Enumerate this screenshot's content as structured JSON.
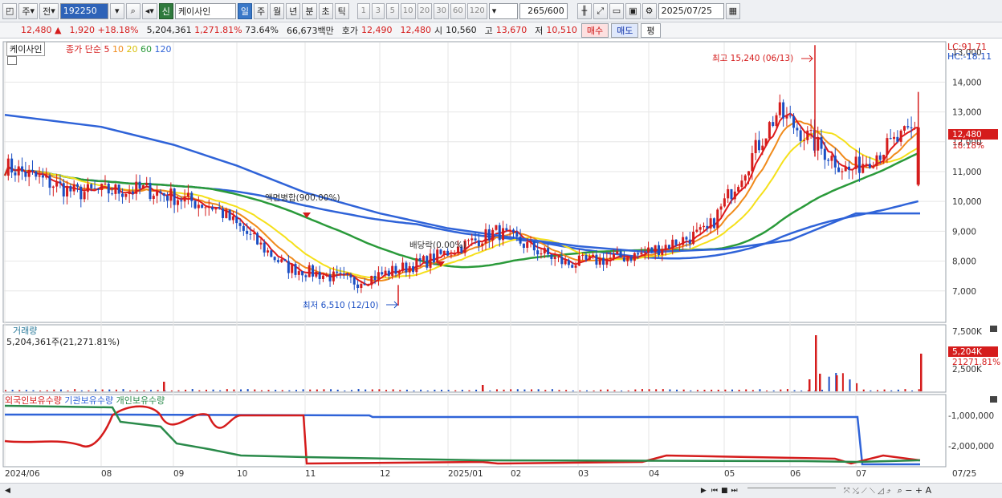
{
  "toolbar": {
    "period": "주",
    "prev": "전",
    "code": "192250",
    "credit_badge": "신",
    "stock_name": "케이사인",
    "intervals": [
      "일",
      "주",
      "월",
      "년",
      "분",
      "초",
      "틱"
    ],
    "active_interval": "일",
    "steps": [
      "1",
      "3",
      "5",
      "10",
      "20",
      "30",
      "60",
      "120"
    ],
    "count": "265",
    "count_total": "/600",
    "date": "2025/07/25"
  },
  "quote": {
    "price": "12,480",
    "arrow": "▲",
    "change": "1,920",
    "change_pct": "+18.18%",
    "volume": "5,204,361",
    "volume_pct": "1,271.81%",
    "turnover": "73.64%",
    "amount": "66,673백만",
    "hoga_label": "호가",
    "hoga1": "12,490",
    "hoga2": "12,480",
    "open_label": "시",
    "open": "10,560",
    "high_label": "고",
    "high": "13,670",
    "low_label": "저",
    "low": "10,510",
    "buy": "매수",
    "sell": "매도",
    "eval": "평"
  },
  "colors": {
    "up": "#d51c1c",
    "down": "#1b4fc4",
    "ma5": "#e01a1a",
    "ma10": "#f08a1a",
    "ma20": "#f5e01a",
    "ma60": "#2a9a3a",
    "ma120": "#2f63d8",
    "foreign": "#d51c1c",
    "institution": "#2f63d8",
    "individual": "#2a8a4a"
  },
  "price_panel": {
    "stock_label": "케이사인",
    "legend_prefix": "종가 단순",
    "ma_periods": [
      "5",
      "10",
      "20",
      "60",
      "120"
    ],
    "lc": "LC:91.71",
    "hc": "HC:-18.11",
    "high_note": "최고 15,240 (06/13)",
    "low_note": "최저 6,510 (12/10)",
    "event1": "액면병합(900.00%)",
    "event2": "배당락(0.00%)",
    "current_price_tag": "12,480",
    "current_pct_tag": "18.18%",
    "y_ticks": [
      "13,000",
      "14,000",
      "13,000",
      "12,000",
      "11,000",
      "10,000",
      "9,000",
      "8,000",
      "7,000"
    ]
  },
  "volume_panel": {
    "title": "거래량",
    "value": "5,204,361주(21,271.81%)",
    "y_ticks": [
      "7,500K",
      "2,500K"
    ],
    "current_tag": "5,204K",
    "current_pct_tag": "21271.81%"
  },
  "holding_panel": {
    "series": [
      "외국인보유수량",
      "기관보유수량",
      "개인보유수량"
    ],
    "y_ticks": [
      "-1,000,000",
      "-2,000,000"
    ]
  },
  "x_axis": [
    "2024/06",
    "08",
    "09",
    "10",
    "11",
    "12",
    "2025/01",
    "02",
    "03",
    "04",
    "05",
    "06",
    "07",
    "07/25"
  ],
  "chart_data": {
    "type": "candlestick",
    "price_ylim": [
      6000,
      15300
    ],
    "x_labels": [
      "2024/06",
      "08",
      "09",
      "10",
      "11",
      "12",
      "2025/01",
      "02",
      "03",
      "04",
      "05",
      "06",
      "07"
    ],
    "close_by_month": [
      11200,
      10300,
      10400,
      9800,
      7800,
      7300,
      8000,
      9000,
      7900,
      8200,
      9000,
      13000,
      11000
    ],
    "ma120_by_month": [
      12900,
      12500,
      11900,
      11200,
      10300,
      9600,
      9100,
      8800,
      8500,
      8300,
      8400,
      8700,
      9600
    ],
    "last_close": 12480,
    "last_high": 13670,
    "last_low": 10510,
    "last_open": 10560,
    "high_point": {
      "date": "06/13",
      "value": 15240
    },
    "low_point": {
      "date": "12/10",
      "value": 6510
    }
  }
}
